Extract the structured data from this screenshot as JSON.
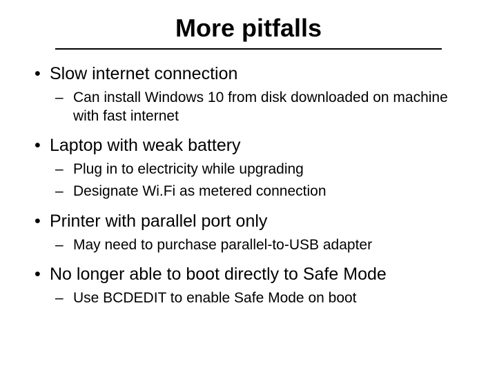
{
  "title": "More pitfalls",
  "bullets": [
    {
      "text": "Slow internet connection",
      "sub": [
        "Can install Windows 10 from disk downloaded on machine with fast internet"
      ]
    },
    {
      "text": "Laptop with weak battery",
      "sub": [
        "Plug in to electricity while upgrading",
        "Designate Wi.Fi as metered connection"
      ]
    },
    {
      "text": "Printer with parallel port only",
      "sub": [
        "May need to purchase parallel-to-USB adapter"
      ]
    },
    {
      "text": "No longer able to boot directly to Safe Mode",
      "sub": [
        "Use BCDEDIT to enable Safe Mode on boot"
      ]
    }
  ]
}
